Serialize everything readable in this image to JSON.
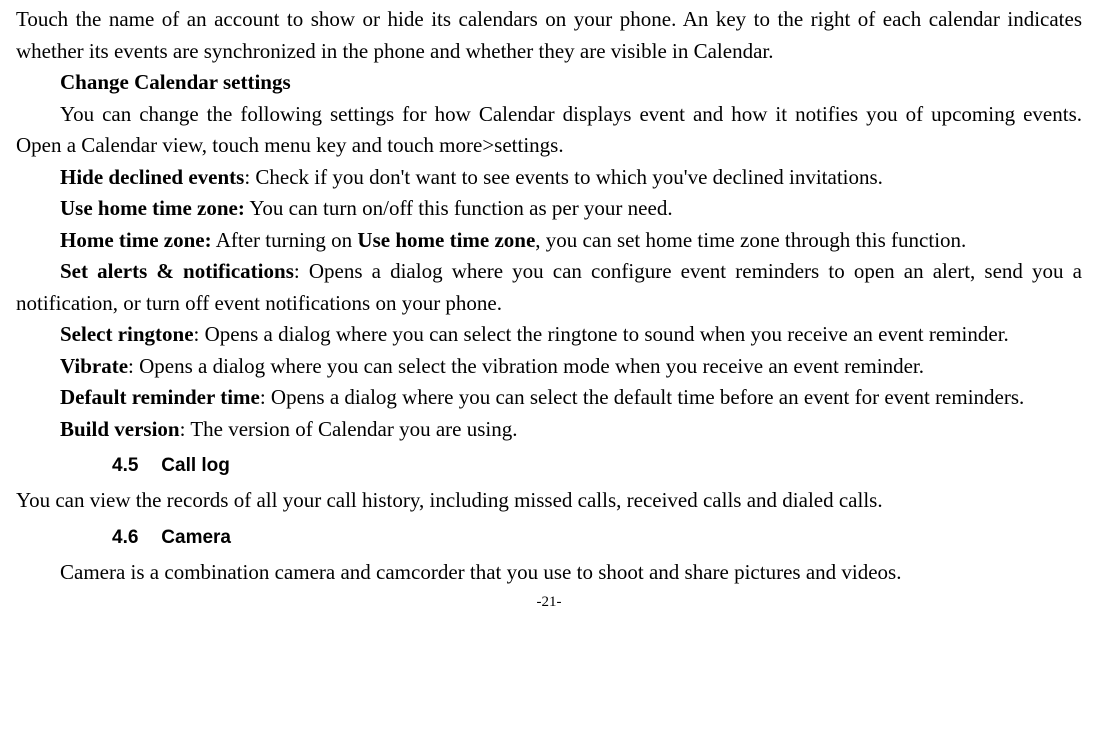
{
  "p1": "Touch the name of an account to show or hide its calendars on your phone. An key to the right of each calendar indicates whether its events are synchronized in the phone and whether they are visible in Calendar.",
  "h_change": "Change Calendar settings",
  "p_change": "You can change the following settings for how Calendar displays event and how it notifies you of upcoming events. Open a Calendar view, touch menu key and touch more>settings.",
  "h_hide": "Hide declined events",
  "p_hide": ": Check if you don't want to see events to which you've declined invitations.",
  "h_usehome": "Use home time zone:",
  "p_usehome": " You can turn on/off this function as per your need.",
  "h_hometz": "Home time zone:",
  "p_hometz_a": " After turning on ",
  "h_hometz_inline": "Use home time zone",
  "p_hometz_b": ", you can set home time zone through this function.",
  "h_alerts": "Set alerts & notifications",
  "p_alerts": ": Opens a dialog where you can configure event reminders to open an alert, send you a notification, or turn off event notifications on your phone.",
  "h_ring": "Select ringtone",
  "p_ring": ": Opens a dialog where you can select the ringtone to sound when you receive an event reminder.",
  "h_vib": "Vibrate",
  "p_vib": ": Opens a dialog where you can select the vibration mode when you receive an event reminder.",
  "h_def": "Default reminder time",
  "p_def": ": Opens a dialog where you can select the default time before an event for event reminders.",
  "h_build": "Build version",
  "p_build": ": The version of Calendar you are using.",
  "sec45_num": "4.5",
  "sec45_title": "Call log",
  "p_calllog": "You can view the records of all your call history, including missed calls, received calls and dialed calls.",
  "sec46_num": "4.6",
  "sec46_title": "Camera",
  "p_camera": "Camera is a combination camera and camcorder that you use to shoot and share pictures and videos.",
  "page_number": "-21-"
}
